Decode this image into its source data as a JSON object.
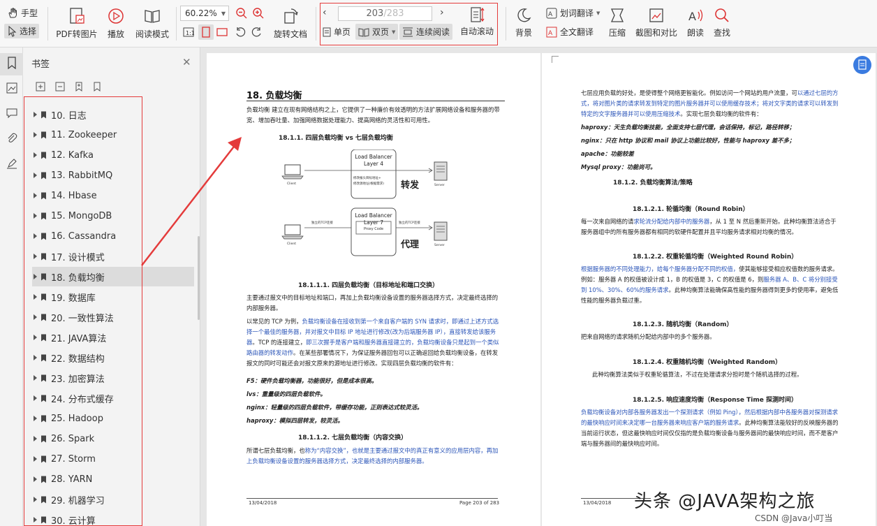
{
  "toolbar": {
    "hand_label": "手型",
    "select_label": "选择",
    "pdf_to_image": "PDF转图片",
    "play": "播放",
    "read_mode": "阅读模式",
    "zoom_value": "60.22%",
    "rotate_doc": "旋转文档",
    "page_current": "203",
    "page_total": "/283",
    "single_page": "单页",
    "double_page": "双页",
    "continuous": "连续阅读",
    "auto_scroll": "自动滚动",
    "background": "背景",
    "word_translate": "划词翻译",
    "full_translate": "全文翻译",
    "compress": "压缩",
    "screenshot_compare": "截图和对比",
    "read_aloud": "朗读",
    "find": "查找"
  },
  "panel": {
    "title": "书签",
    "items": [
      {
        "label": "10. 日志"
      },
      {
        "label": "11. Zookeeper"
      },
      {
        "label": "12. Kafka"
      },
      {
        "label": "13. RabbitMQ"
      },
      {
        "label": "14. Hbase"
      },
      {
        "label": "15. MongoDB"
      },
      {
        "label": "16. Cassandra"
      },
      {
        "label": "17. 设计模式"
      },
      {
        "label": "18. 负载均衡"
      },
      {
        "label": "19. 数据库"
      },
      {
        "label": "20. 一致性算法"
      },
      {
        "label": "21. JAVA算法"
      },
      {
        "label": "22. 数据结构"
      },
      {
        "label": "23. 加密算法"
      },
      {
        "label": "24. 分布式缓存"
      },
      {
        "label": "25. Hadoop"
      },
      {
        "label": "26. Spark"
      },
      {
        "label": "27. Storm"
      },
      {
        "label": "28. YARN"
      },
      {
        "label": "29. 机器学习"
      },
      {
        "label": "30. 云计算"
      }
    ],
    "selected_index": 8
  },
  "left_page": {
    "heading": "18.  负载均衡",
    "intro": "负载均衡 建立在现有网络结构之上，它提供了一种廉价有效透明的方法扩展网络设备和服务器的带宽、增加吞吐量、加强网络数据处理能力、提高网络的灵活性和可用性。",
    "sec_1811": "18.1.1.    四层负载均衡 vs 七层负载均衡",
    "diagram": {
      "lb4_title_1": "Load Balancer",
      "lb4_title_2": "Layer 4",
      "lb4_note_1": "修改报头目标地址+",
      "lb4_note_2": "修改源地址(根据需求)",
      "lb7_title_1": "Load Balancer",
      "lb7_title_2": "Layer 7",
      "proxy_code": "Proxy Code",
      "tcp_left": "独立的TCP连接",
      "tcp_right": "独立的TCP连接",
      "client": "Client",
      "server": "Server",
      "forward": "转发",
      "proxy": "代理"
    },
    "sec_18111": "18.1.1.1.    四层负载均衡（目标地址和端口交换）",
    "p1": "主要通过报文中的目标地址和端口，再加上负载均衡设备设置的服务器选择方式，决定最终选择的内部服务器。",
    "p2_a": "以常见的 TCP 为例，",
    "p2_b": "负载均衡设备在接收到第一个来自客户端的 SYN 请求时，即通过上述方式选择一个最佳的服务器，并对报文中目标 IP 地址进行修改(改为后端服务器 IP），直接转发给该服务器",
    "p2_c": "。TCP 的连接建立，",
    "p2_d": "即三次握手是客户端和服务器直接建立的，负载均衡设备只是起到一个类似路由器的转发动作",
    "p2_e": "。在某些部署情况下，为保证服务器回包可以正确返回给负载均衡设备，在转发报文的同时可能还会对报文原来的源地址进行修改。实现四层负载均衡的软件有：",
    "f5": "F5：硬件负载均衡器，功能很好，但是成本很高。",
    "lvs": "lvs：重量级的四层负载软件。",
    "nginx": "nginx：轻量级的四层负载软件，带缓存功能，正则表达式较灵活。",
    "haproxy": "haproxy：模拟四层转发，较灵活。",
    "sec_18112": "18.1.1.2.    七层负载均衡（内容交换）",
    "p3_a": "所谓七层负载均衡，也",
    "p3_b": "称为“内容交换”，也就是主要通过报文中的真正有意义的应用层内容，再加上负载均衡设备设置的服务器选择方式，决定最终选择的内部服务器。",
    "footer_date": "13/04/2018",
    "footer_page": "Page 203 of 283"
  },
  "right_page": {
    "p0_a": "七层应用负载的好处，是使得整个网络更智能化。例如访问一个网站的用户流量，可",
    "p0_b": "以通过七层的方式，将对图片类的请求转发到特定的图片服务器并可以使用缓存技术；将对文字类的请求可以转发到特定的文字服务器并可以使用压缩技术",
    "p0_c": "。实现七层负载均衡的软件有：",
    "haproxy": "haproxy：天生负载均衡技能，全面支持七层代理，会话保持，标记，路径转移；",
    "nginx": "nginx：只在 http 协议和 mail 协议上功能比较好，性能与 haproxy 差不多；",
    "apache": "apache：功能较差",
    "mysql": "Mysql proxy：功能尚可。",
    "sec_1812": "18.1.2.     负载均衡算法/策略",
    "sec_18121": "18.1.2.1.  轮循均衡（Round Robin）",
    "p1_a": "每一次来自网络的请",
    "p1_b": "求轮流分配给内部中的服务器",
    "p1_c": "，从 1 至 N 然后重新开始。此种均衡算法适合于服务器组中的所有服务器都有相同的软硬件配置并且平均服务请求相对均衡的情况。",
    "sec_18122": "18.1.2.2.  权重轮循均衡（Weighted Round Robin）",
    "p2_a": "根据服务器的不同处理能力，给每个服务器分配不同的权值，",
    "p2_b": "使其能够接受相应权值数的服务请求。例如：服务器 A 的权值被设计成 1，B 的权值是 3，C 的权值是 6，则",
    "p2_c": "服务器 A、B、C 将分别接受到 10%、30%、60%的服务请求",
    "p2_d": "。此种均衡算法能确保高性能的服务器得到更多的使用率，避免低性能的服务器负载过重。",
    "sec_18123": "18.1.2.3.  随机均衡（Random）",
    "p3": "把来自网络的请求随机分配给内部中的多个服务器。",
    "sec_18124": "18.1.2.4.  权重随机均衡（Weighted Random）",
    "p4": "此种均衡算法类似于权重轮循算法，不过在处理请求分担时是个随机选择的过程。",
    "sec_18125": "18.1.2.5.  响应速度均衡（Response Time 探测时间）",
    "p5_a": "负载均衡设备对内部各服务器发出一个探测请求（例如 Ping），然后根据内部中各服务器对探测请求的最快响应时间来决定哪一台服务器来响应客户端的服务请求",
    "p5_b": "。此种均衡算法能较好的反映服务器的当前运行状态，但这最快响应时间仅仅指的是负载均衡设备与服务器间的最快响应时间，而不是客户端与服务器间的最快响应时间。",
    "footer_date": "13/04/2018"
  },
  "watermark": "头条 @JAVA架构之旅",
  "csdn": "CSDN @Java小叮当",
  "colors": {
    "accent_red": "#e43b3b",
    "link_blue": "#2a54b8"
  }
}
